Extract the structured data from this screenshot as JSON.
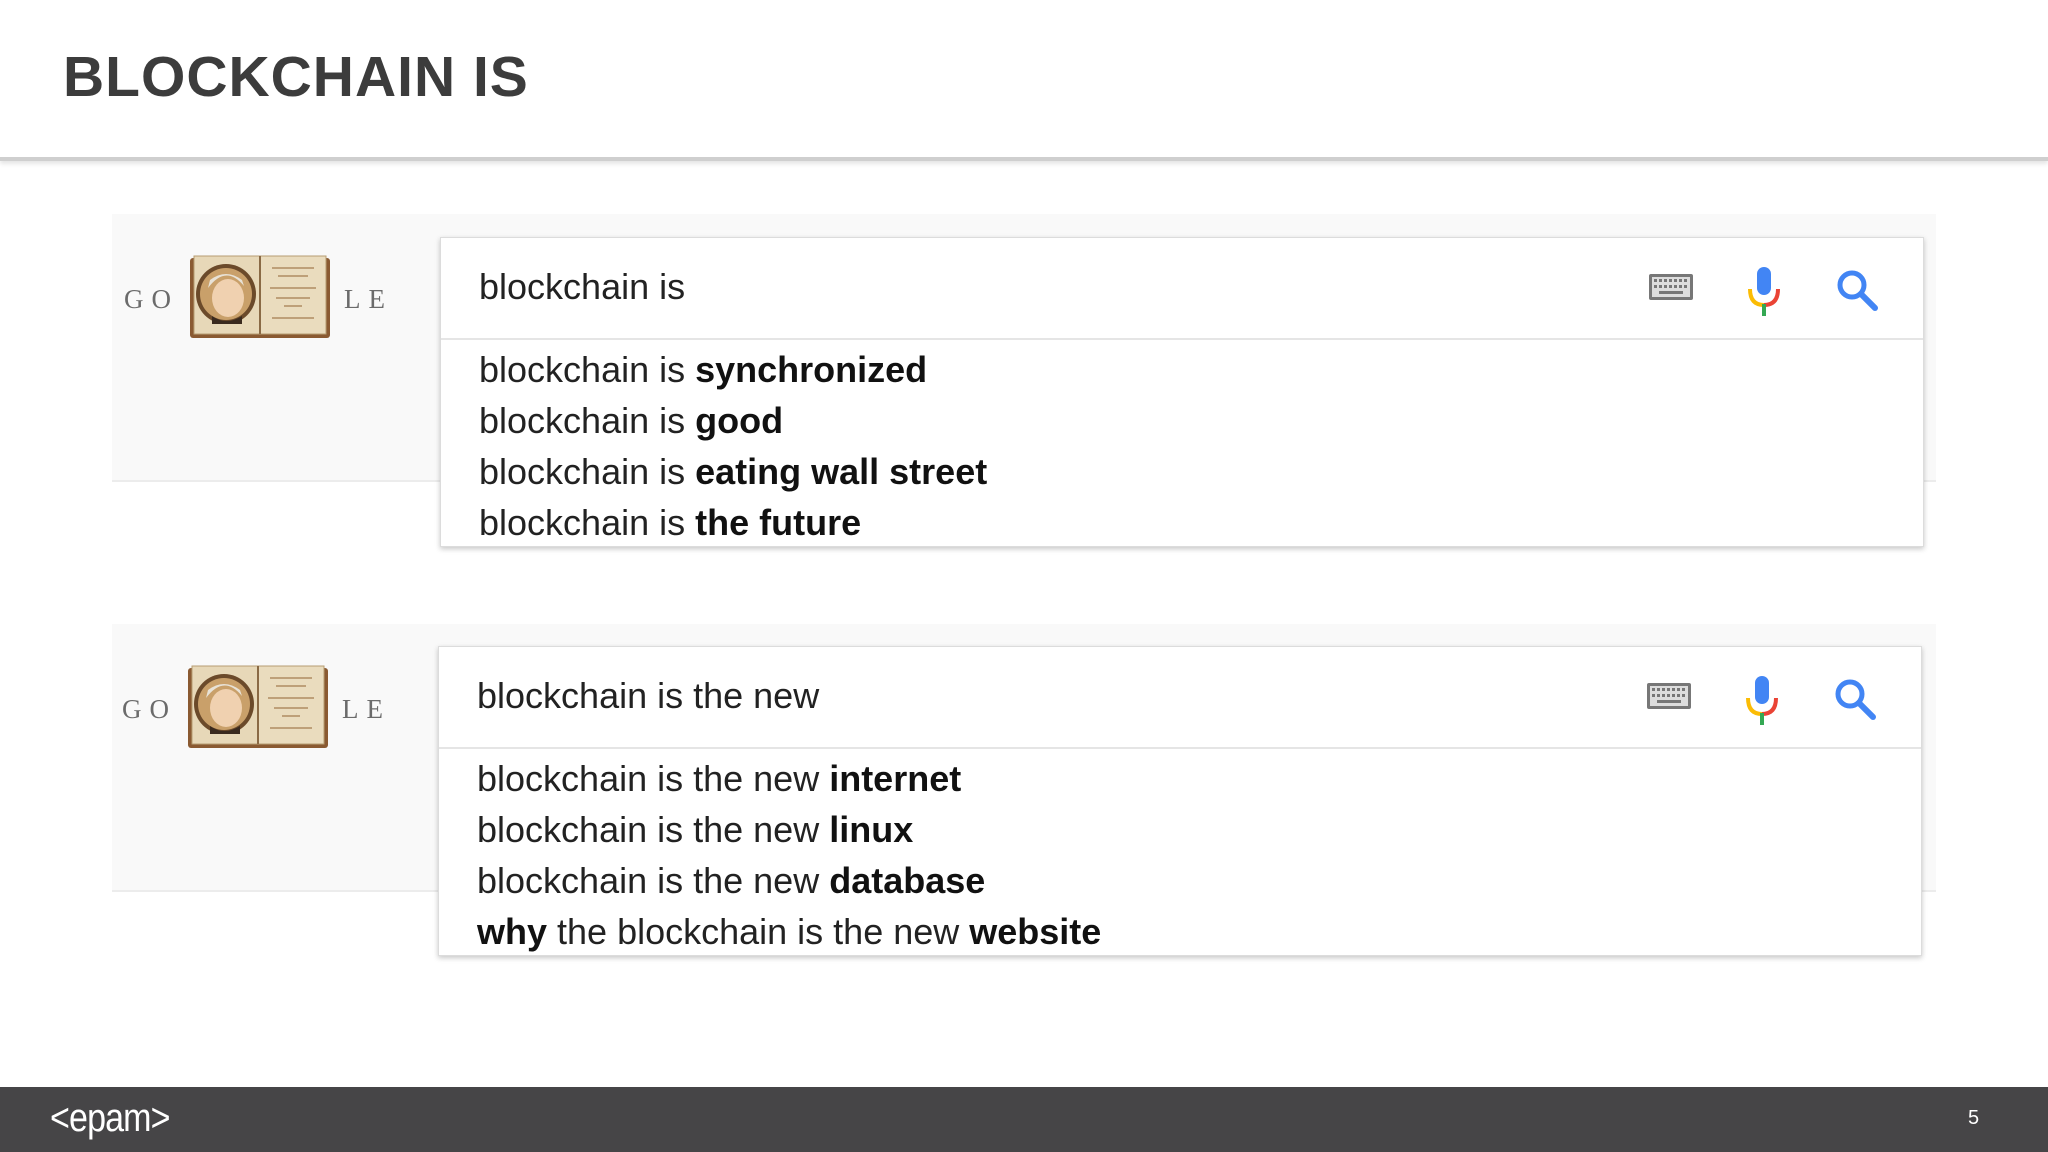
{
  "slide": {
    "title": "BLOCKCHAIN IS",
    "page_number": "5",
    "logo_text": "<epam>"
  },
  "doodle": {
    "letters_left": "GO",
    "letters_right": "LE"
  },
  "searches": [
    {
      "query": "blockchain is",
      "suggestions": [
        {
          "prefix": "blockchain is ",
          "bold": "synchronized",
          "suffix": "",
          "tail": ""
        },
        {
          "prefix": "blockchain is ",
          "bold": "good",
          "suffix": "",
          "tail": ""
        },
        {
          "prefix": "blockchain is ",
          "bold": "eating wall street",
          "suffix": "",
          "tail": ""
        },
        {
          "prefix": "blockchain is ",
          "bold": "the future",
          "suffix": "",
          "tail": ""
        }
      ]
    },
    {
      "query": "blockchain is the new",
      "suggestions": [
        {
          "prefix": "blockchain is the new ",
          "bold": "internet",
          "suffix": "",
          "tail": ""
        },
        {
          "prefix": "blockchain is the new ",
          "bold": "linux",
          "suffix": "",
          "tail": ""
        },
        {
          "prefix": "blockchain is the new ",
          "bold": "database",
          "suffix": "",
          "tail": ""
        },
        {
          "prefix": "",
          "bold": "why",
          "suffix": " the blockchain is the new ",
          "tail": "website"
        }
      ]
    }
  ],
  "icons": {
    "keyboard": "keyboard-icon",
    "mic": "mic-icon",
    "search": "search-icon"
  },
  "colors": {
    "footer": "#464547",
    "title": "#3c3c3c",
    "search_blue": "#4285f4",
    "mic_red": "#ea4335",
    "mic_yellow": "#fbbc05",
    "mic_green": "#34a853"
  }
}
